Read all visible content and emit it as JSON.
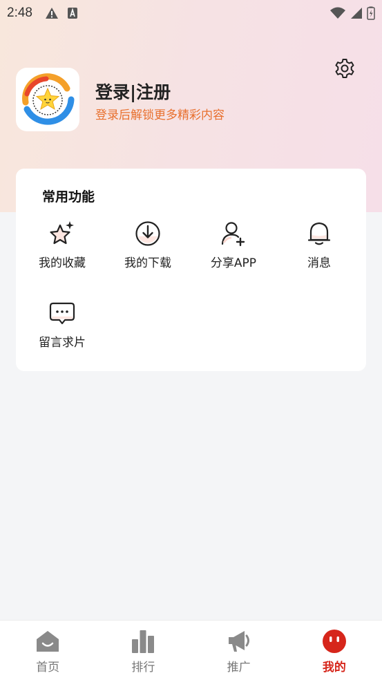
{
  "status_bar": {
    "time": "2:48",
    "icons_left": [
      "warning-icon",
      "a-letter-icon"
    ],
    "icons_right": [
      "wifi-icon",
      "signal-icon",
      "battery-icon"
    ]
  },
  "header": {
    "settings_icon": "gear-icon",
    "login_title": "登录|注册",
    "login_subtitle": "登录后解锁更多精彩内容",
    "subtitle_color": "#e8702e"
  },
  "functions_card": {
    "title": "常用功能",
    "items": [
      {
        "label": "我的收藏",
        "icon": "star-sparkle-icon"
      },
      {
        "label": "我的下载",
        "icon": "download-icon"
      },
      {
        "label": "分享APP",
        "icon": "add-user-icon"
      },
      {
        "label": "消息",
        "icon": "bell-icon"
      },
      {
        "label": "留言求片",
        "icon": "chat-bubble-icon"
      }
    ]
  },
  "tabbar": {
    "active_color": "#d6261b",
    "tabs": [
      {
        "label": "首页",
        "icon": "home-icon",
        "active": false
      },
      {
        "label": "排行",
        "icon": "bar-chart-icon",
        "active": false
      },
      {
        "label": "推广",
        "icon": "megaphone-icon",
        "active": false
      },
      {
        "label": "我的",
        "icon": "smiley-icon",
        "active": true
      }
    ]
  }
}
